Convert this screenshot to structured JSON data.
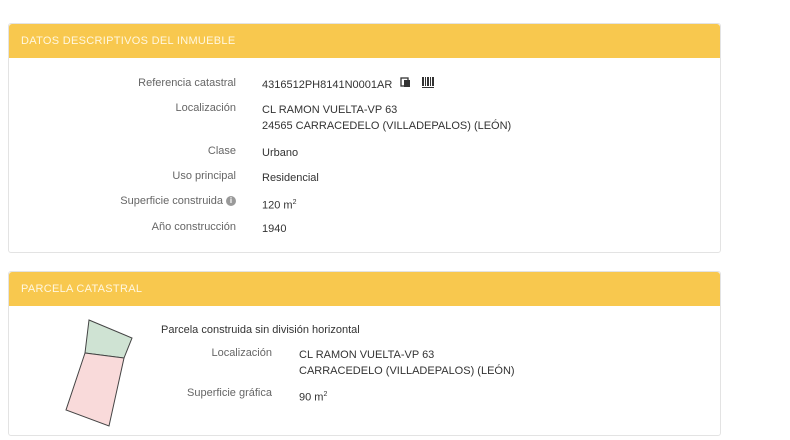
{
  "inmueble": {
    "header": "DATOS DESCRIPTIVOS DEL INMUEBLE",
    "referencia_label": "Referencia catastral",
    "referencia_value": "4316512PH8141N0001AR",
    "localizacion_label": "Localización",
    "localizacion_line1": "CL RAMON VUELTA-VP 63",
    "localizacion_line2": "24565 CARRACEDELO (VILLADEPALOS) (LEÓN)",
    "clase_label": "Clase",
    "clase_value": "Urbano",
    "uso_label": "Uso principal",
    "uso_value": "Residencial",
    "superficie_label": "Superficie construida",
    "superficie_value": "120 m",
    "superficie_exp": "2",
    "anio_label": "Año construcción",
    "anio_value": "1940"
  },
  "parcela": {
    "header": "PARCELA CATASTRAL",
    "tipo": "Parcela construida sin división horizontal",
    "localizacion_label": "Localización",
    "localizacion_line1": "CL RAMON VUELTA-VP 63",
    "localizacion_line2": "CARRACEDELO (VILLADEPALOS) (LEÓN)",
    "superficie_label": "Superficie gráfica",
    "superficie_value": "90 m",
    "superficie_exp": "2"
  },
  "icons": [
    "copy-icon",
    "barcode-icon",
    "info-icon"
  ],
  "colors": {
    "header_bg": "#f8c84e",
    "plot_top": "#cfe3d3",
    "plot_bottom": "#f9dada"
  }
}
